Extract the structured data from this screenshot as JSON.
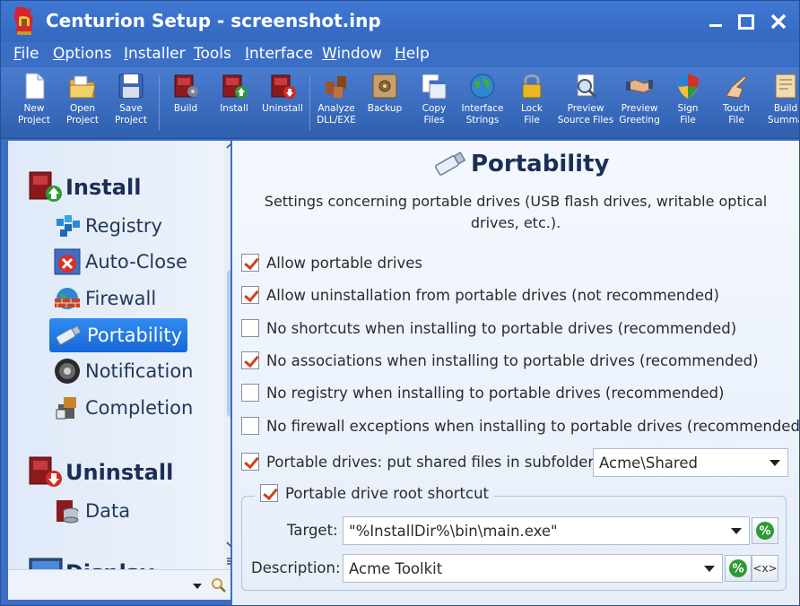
{
  "window": {
    "title": "Centurion Setup - screenshot.inp",
    "controls": {
      "minimize": "minimize-icon",
      "maximize": "maximize-icon",
      "close": "close-icon"
    }
  },
  "menu": [
    {
      "label": "File",
      "u": "F",
      "rest": "ile"
    },
    {
      "label": "Options",
      "u": "O",
      "rest": "ptions"
    },
    {
      "label": "Installer",
      "u": "I",
      "rest": "nstaller"
    },
    {
      "label": "Tools",
      "u": "T",
      "rest": "ools"
    },
    {
      "label": "Interface",
      "u": "I",
      "rest": "nterface"
    },
    {
      "label": "Window",
      "u": "W",
      "rest": "indow"
    },
    {
      "label": "Help",
      "u": "H",
      "rest": "elp"
    }
  ],
  "toolbar": [
    {
      "line1": "New",
      "line2": "Project",
      "icon": "new-file-icon"
    },
    {
      "line1": "Open",
      "line2": "Project",
      "icon": "open-folder-icon"
    },
    {
      "line1": "Save",
      "line2": "Project",
      "icon": "floppy-disk-icon"
    },
    {
      "line1": "Build",
      "line2": "",
      "icon": "build-box-icon"
    },
    {
      "line1": "Install",
      "line2": "",
      "icon": "install-box-icon"
    },
    {
      "line1": "Uninstall",
      "line2": "",
      "icon": "uninstall-box-icon"
    },
    {
      "line1": "Analyze",
      "line2": "DLL/EXE",
      "icon": "analyze-icon"
    },
    {
      "line1": "Backup",
      "line2": "",
      "icon": "safe-icon"
    },
    {
      "line1": "Copy",
      "line2": "Files",
      "icon": "copy-files-icon"
    },
    {
      "line1": "Interface",
      "line2": "Strings",
      "icon": "globe-icon"
    },
    {
      "line1": "Lock",
      "line2": "File",
      "icon": "padlock-icon"
    },
    {
      "line1": "Preview",
      "line2": "Source Files",
      "icon": "magnifier-icon"
    },
    {
      "line1": "Preview",
      "line2": "Greeting",
      "icon": "handshake-icon"
    },
    {
      "line1": "Sign",
      "line2": "File",
      "icon": "shield-icon"
    },
    {
      "line1": "Touch",
      "line2": "File",
      "icon": "pointing-hand-icon"
    },
    {
      "line1": "Build",
      "line2": "Summa",
      "icon": "scroll-icon"
    }
  ],
  "sidebar": {
    "install_header": "Install",
    "install_items": [
      "Registry",
      "Auto-Close",
      "Firewall",
      "Portability",
      "Notification",
      "Completion"
    ],
    "selected": "Portability",
    "uninstall_header": "Uninstall",
    "uninstall_items": [
      "Data"
    ],
    "next_header_partial": "Display"
  },
  "page": {
    "title": "Portability",
    "description": "Settings concerning portable drives (USB flash drives, writable optical drives, etc.).",
    "options": [
      {
        "label": "Allow portable drives",
        "checked": true
      },
      {
        "label": "Allow uninstallation from portable drives (not recommended)",
        "checked": true
      },
      {
        "label": "No shortcuts when installing to portable drives (recommended)",
        "checked": false
      },
      {
        "label": "No associations when installing to portable drives (recommended)",
        "checked": true
      },
      {
        "label": "No registry when installing to portable drives (recommended)",
        "checked": false
      },
      {
        "label": "No firewall exceptions when installing to portable drives (recommended)",
        "checked": false
      }
    ],
    "subfolder": {
      "label": "Portable drives: put shared files in subfolder:",
      "checked": true,
      "value": "Acme\\Shared"
    },
    "shortcut_group": {
      "label": "Portable drive root shortcut",
      "checked": true,
      "target_label": "Target:",
      "target_value": "\"%InstallDir%\\bin\\main.exe\"",
      "description_label": "Description:",
      "description_value": "Acme Toolkit",
      "var_button": "%",
      "token_button": "<x>"
    }
  },
  "colors": {
    "titlebar": "#3b6fc6",
    "selection": "#1f78e6",
    "check": "#d0401b"
  }
}
